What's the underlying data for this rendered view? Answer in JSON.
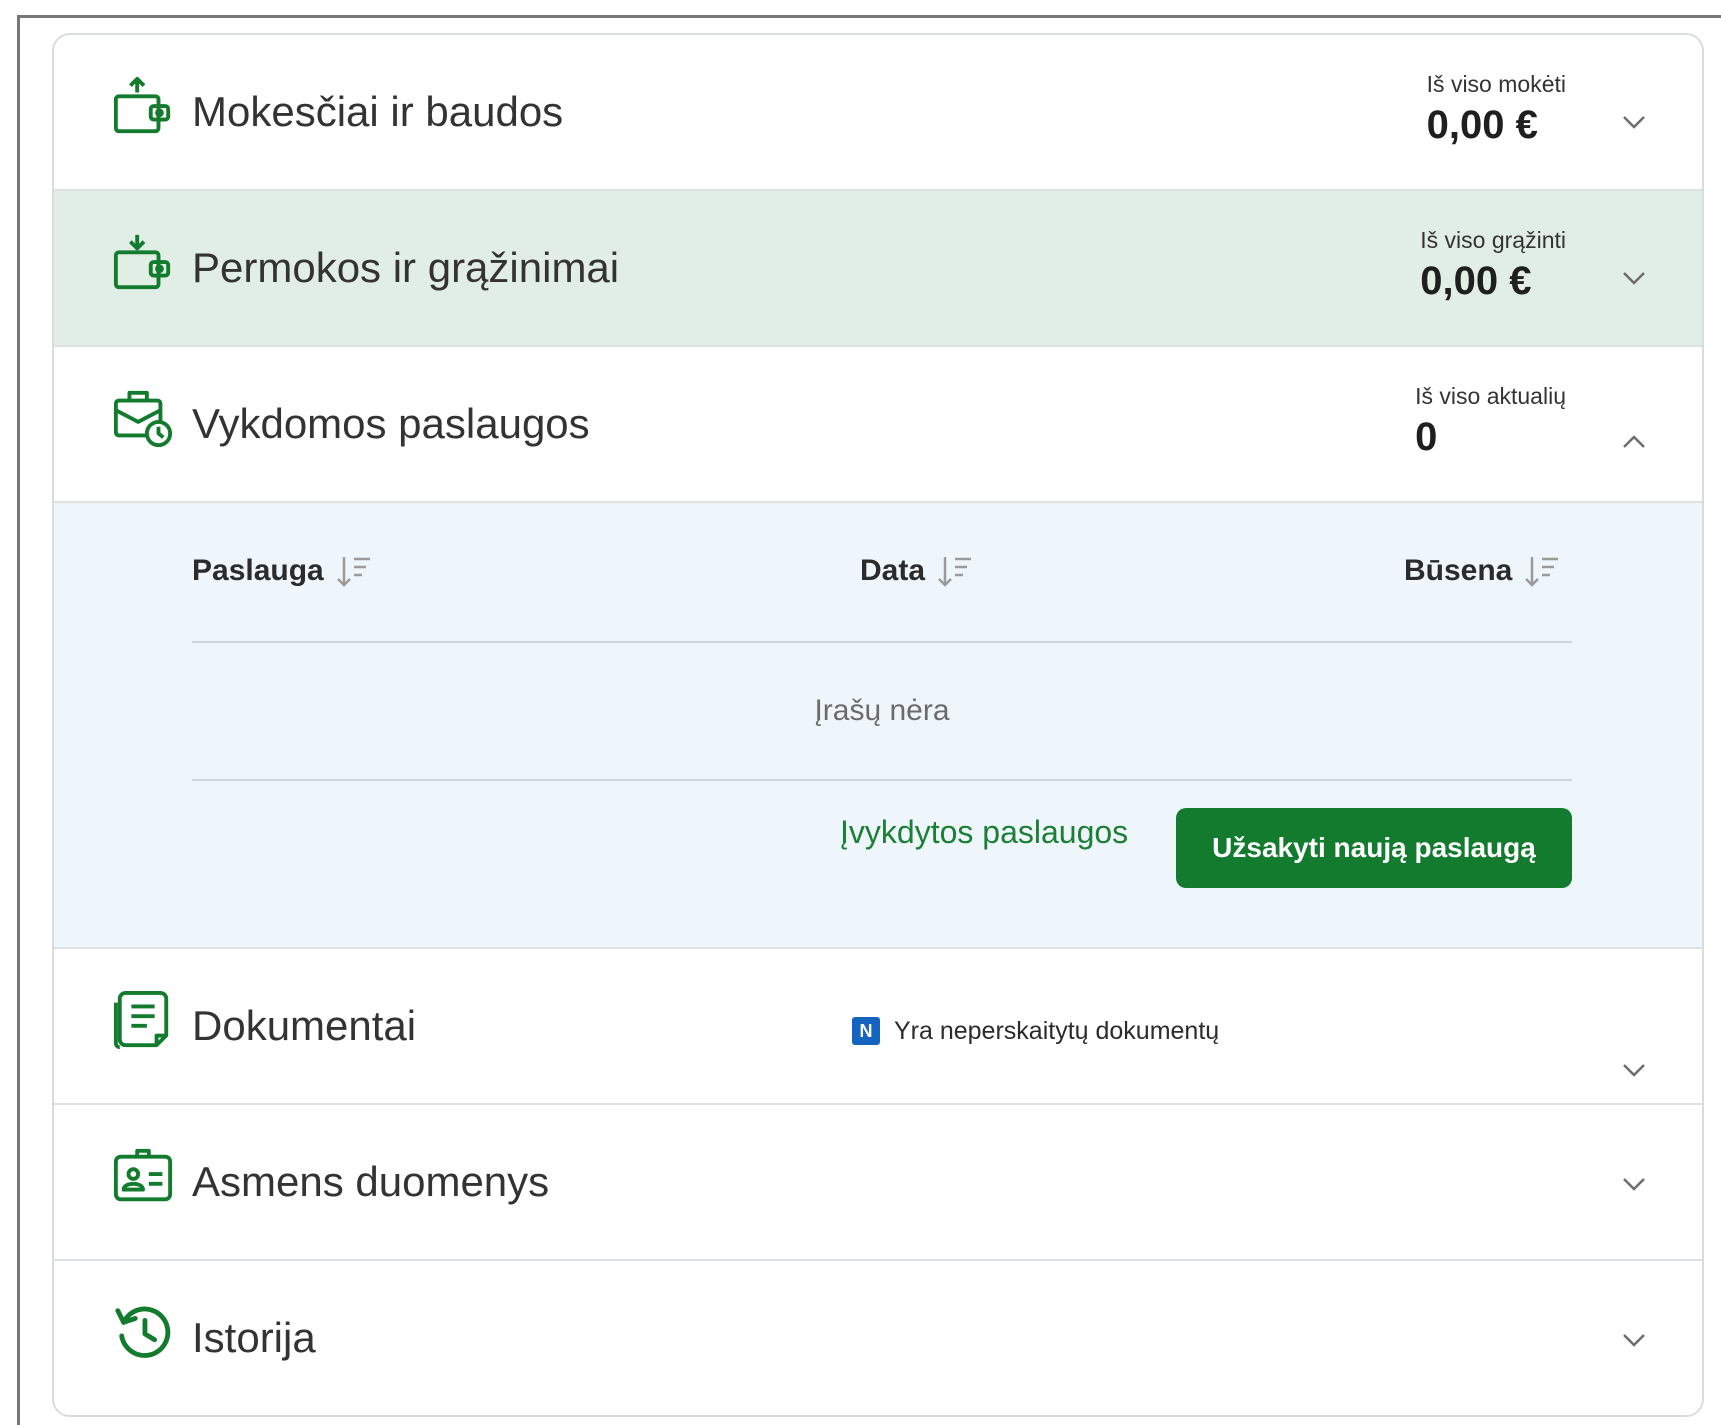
{
  "sections": [
    {
      "title": "Mokesčiai ir baudos",
      "summary_label": "Iš viso mokėti",
      "summary_value": "0,00 €",
      "icon": "wallet-out-icon"
    },
    {
      "title": "Permokos ir grąžinimai",
      "summary_label": "Iš viso grąžinti",
      "summary_value": "0,00 €",
      "icon": "wallet-in-icon"
    },
    {
      "title": "Vykdomos paslaugos",
      "summary_label": "Iš viso aktualių",
      "summary_value": "0",
      "icon": "briefcase-clock-icon"
    },
    {
      "title": "Dokumentai",
      "icon": "documents-icon"
    },
    {
      "title": "Asmens duomenys",
      "icon": "id-card-icon"
    },
    {
      "title": "Istorija",
      "icon": "history-icon"
    }
  ],
  "services_panel": {
    "columns": [
      "Paslauga",
      "Data",
      "Būsena"
    ],
    "empty_text": "Įrašų nėra",
    "completed_link": "Įvykdytos paslaugos",
    "order_button": "Užsakyti naują paslaugą"
  },
  "documents_notice": {
    "badge": "N",
    "text": "Yra neperskaitytų dokumentų"
  },
  "colors": {
    "accent_green": "#137b2e",
    "highlight_row": "#e1eee6",
    "panel_bg": "#eff6fb",
    "badge_blue": "#1565c0"
  }
}
